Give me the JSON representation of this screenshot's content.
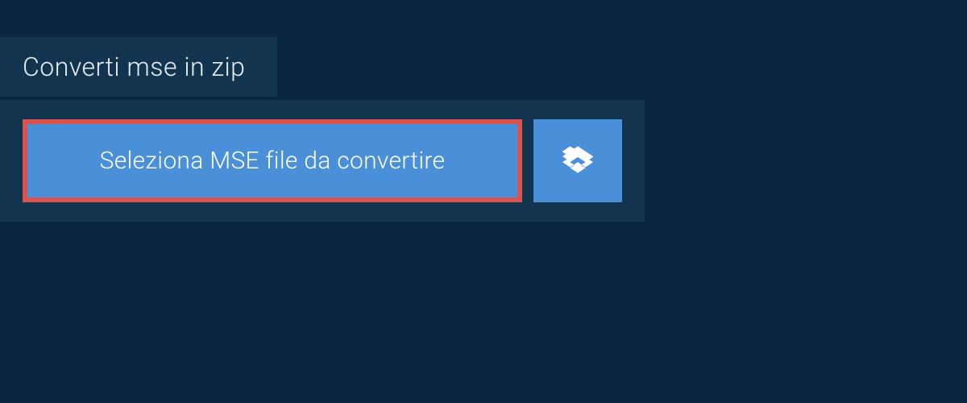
{
  "tab": {
    "title": "Converti mse in zip"
  },
  "actions": {
    "select_file_label": "Seleziona MSE file da convertire"
  },
  "colors": {
    "background": "#0a2640",
    "panel": "#13344f",
    "button": "#4a90d9",
    "highlight_border": "#d9534f"
  }
}
